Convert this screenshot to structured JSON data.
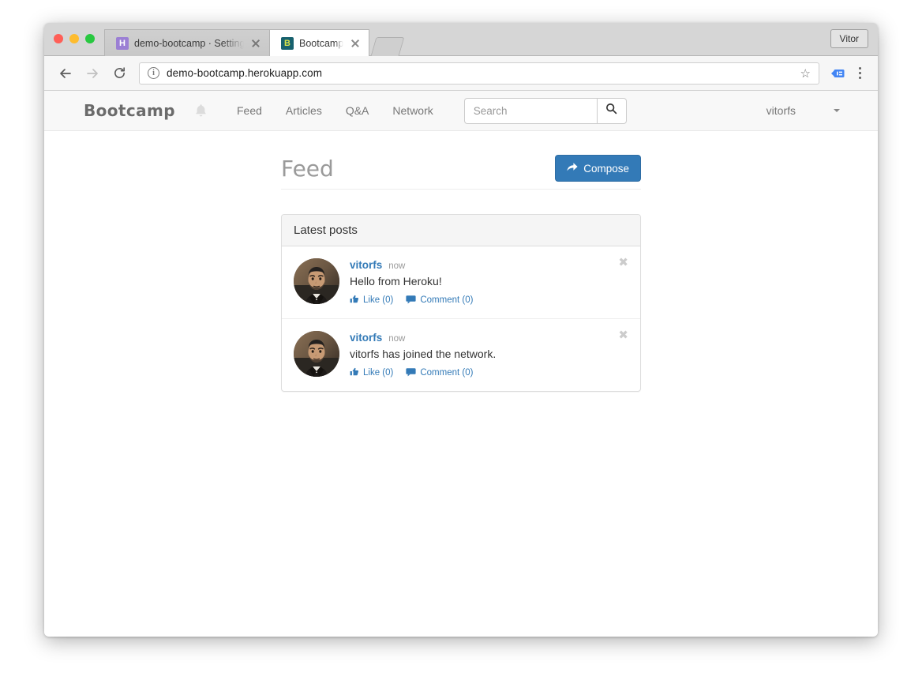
{
  "browser": {
    "profile_button": "Vitor",
    "tabs": [
      {
        "title": "demo-bootcamp · Settings | He",
        "favicon": "heroku-icon",
        "favicon_letter": "H",
        "active": false
      },
      {
        "title": "Bootcamp",
        "favicon": "bootcamp-icon",
        "favicon_letter": "B",
        "active": true
      }
    ],
    "toolbar": {
      "back_icon": "back-arrow-icon",
      "forward_icon": "forward-arrow-icon",
      "reload_icon": "reload-icon",
      "info_icon": "info-circle-icon",
      "info_glyph": "i",
      "url": "demo-bootcamp.herokuapp.com",
      "star_icon": "star-icon",
      "extension_icon": "extension-icon",
      "menu_icon": "kebab-menu-icon"
    }
  },
  "site": {
    "navbar": {
      "brand": "Bootcamp",
      "bell_icon": "bell-icon",
      "links": [
        {
          "label": "Feed"
        },
        {
          "label": "Articles"
        },
        {
          "label": "Q&A"
        },
        {
          "label": "Network"
        }
      ],
      "search": {
        "placeholder": "Search",
        "value": "",
        "button_icon": "search-icon"
      },
      "user": {
        "name": "vitorfs",
        "caret_icon": "chevron-down-icon"
      }
    },
    "main": {
      "title": "Feed",
      "compose_button": {
        "label": "Compose",
        "icon": "share-arrow-icon",
        "color": "#337ab7"
      },
      "panel": {
        "header": "Latest posts",
        "posts": [
          {
            "user": "vitorfs",
            "time": "now",
            "text": "Hello from Heroku!",
            "like_label": "Like (0)",
            "comment_label": "Comment (0)",
            "like_icon": "thumbs-up-icon",
            "comment_icon": "comment-bubble-icon",
            "dismiss_icon": "close-icon",
            "avatar": "user-avatar"
          },
          {
            "user": "vitorfs",
            "time": "now",
            "text": "vitorfs has joined the network.",
            "like_label": "Like (0)",
            "comment_label": "Comment (0)",
            "like_icon": "thumbs-up-icon",
            "comment_icon": "comment-bubble-icon",
            "dismiss_icon": "close-icon",
            "avatar": "user-avatar"
          }
        ]
      }
    }
  },
  "colors": {
    "accent": "#337ab7",
    "navbar_bg": "#f8f8f8",
    "panel_head_bg": "#f5f5f5",
    "muted_text": "#999999"
  }
}
